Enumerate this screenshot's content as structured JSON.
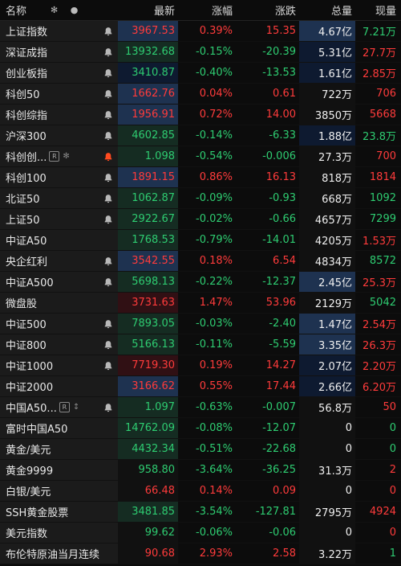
{
  "header": {
    "name": "名称",
    "latest": "最新",
    "pct": "涨幅",
    "chg": "涨跌",
    "volume": "总量",
    "current": "现量",
    "icons": [
      "settings-icon",
      "dot-icon"
    ]
  },
  "rows": [
    {
      "name": "上证指数",
      "bell": true,
      "latest": "3967.53",
      "pct": "0.39%",
      "chg": "15.35",
      "volume": "4.67亿",
      "current": "7.21万",
      "dir": "up",
      "curColor": "green"
    },
    {
      "name": "深证成指",
      "bell": true,
      "latest": "13932.68",
      "pct": "-0.15%",
      "chg": "-20.39",
      "volume": "5.31亿",
      "current": "27.7万",
      "dir": "down",
      "curColor": "red"
    },
    {
      "name": "创业板指",
      "bell": true,
      "latest": "3410.87",
      "pct": "-0.40%",
      "chg": "-13.53",
      "volume": "1.61亿",
      "current": "2.85万",
      "dir": "down",
      "curColor": "red"
    },
    {
      "name": "科创50",
      "bell": true,
      "latest": "1662.76",
      "pct": "0.04%",
      "chg": "0.61",
      "volume": "722万",
      "current": "706",
      "dir": "up",
      "curColor": "red"
    },
    {
      "name": "科创综指",
      "bell": true,
      "latest": "1956.91",
      "pct": "0.72%",
      "chg": "14.00",
      "volume": "3850万",
      "current": "5668",
      "dir": "up",
      "curColor": "red"
    },
    {
      "name": "沪深300",
      "bell": true,
      "latest": "4602.85",
      "pct": "-0.14%",
      "chg": "-6.33",
      "volume": "1.88亿",
      "current": "23.8万",
      "dir": "down",
      "curColor": "green"
    },
    {
      "name": "科创创...",
      "bell": true,
      "bellActive": true,
      "badges": true,
      "latest": "1.098",
      "pct": "-0.54%",
      "chg": "-0.006",
      "volume": "27.3万",
      "current": "700",
      "dir": "down",
      "curColor": "red"
    },
    {
      "name": "科创100",
      "bell": true,
      "latest": "1891.15",
      "pct": "0.86%",
      "chg": "16.13",
      "volume": "818万",
      "current": "1814",
      "dir": "up",
      "curColor": "red"
    },
    {
      "name": "北证50",
      "bell": true,
      "latest": "1062.87",
      "pct": "-0.09%",
      "chg": "-0.93",
      "volume": "668万",
      "current": "1092",
      "dir": "down",
      "curColor": "green"
    },
    {
      "name": "上证50",
      "bell": true,
      "latest": "2922.67",
      "pct": "-0.02%",
      "chg": "-0.66",
      "volume": "4657万",
      "current": "7299",
      "dir": "down",
      "curColor": "green"
    },
    {
      "name": "中证A50",
      "bell": false,
      "latest": "1768.53",
      "pct": "-0.79%",
      "chg": "-14.01",
      "volume": "4205万",
      "current": "1.53万",
      "dir": "down",
      "curColor": "red"
    },
    {
      "name": "央企红利",
      "bell": true,
      "latest": "3542.55",
      "pct": "0.18%",
      "chg": "6.54",
      "volume": "4834万",
      "current": "8572",
      "dir": "up",
      "curColor": "green"
    },
    {
      "name": "中证A500",
      "bell": true,
      "latest": "5698.13",
      "pct": "-0.22%",
      "chg": "-12.37",
      "volume": "2.45亿",
      "current": "25.3万",
      "dir": "down",
      "curColor": "red"
    },
    {
      "name": "微盘股",
      "bell": false,
      "latest": "3731.63",
      "pct": "1.47%",
      "chg": "53.96",
      "volume": "2129万",
      "current": "5042",
      "dir": "up",
      "curColor": "green"
    },
    {
      "name": "中证500",
      "bell": true,
      "latest": "7893.05",
      "pct": "-0.03%",
      "chg": "-2.40",
      "volume": "1.47亿",
      "current": "2.54万",
      "dir": "down",
      "curColor": "red"
    },
    {
      "name": "中证800",
      "bell": true,
      "latest": "5166.13",
      "pct": "-0.11%",
      "chg": "-5.59",
      "volume": "3.35亿",
      "current": "26.3万",
      "dir": "down",
      "curColor": "red"
    },
    {
      "name": "中证1000",
      "bell": true,
      "latest": "7719.30",
      "pct": "0.19%",
      "chg": "14.27",
      "volume": "2.07亿",
      "current": "2.20万",
      "dir": "up",
      "curColor": "red"
    },
    {
      "name": "中证2000",
      "bell": false,
      "latest": "3166.62",
      "pct": "0.55%",
      "chg": "17.44",
      "volume": "2.66亿",
      "current": "6.20万",
      "dir": "up",
      "curColor": "red"
    },
    {
      "name": "中国A50...",
      "bell": true,
      "badges2": true,
      "latest": "1.097",
      "pct": "-0.63%",
      "chg": "-0.007",
      "volume": "56.8万",
      "current": "50",
      "dir": "down",
      "curColor": "red"
    },
    {
      "name": "富时中国A50",
      "bell": false,
      "latest": "14762.09",
      "pct": "-0.08%",
      "chg": "-12.07",
      "volume": "0",
      "current": "0",
      "dir": "down",
      "curColor": "green"
    },
    {
      "name": "黄金/美元",
      "bell": false,
      "latest": "4432.34",
      "pct": "-0.51%",
      "chg": "-22.68",
      "volume": "0",
      "current": "0",
      "dir": "down",
      "curColor": "green"
    },
    {
      "name": "黄金9999",
      "bell": false,
      "latest": "958.80",
      "pct": "-3.64%",
      "chg": "-36.25",
      "volume": "31.3万",
      "current": "2",
      "dir": "down",
      "curColor": "red"
    },
    {
      "name": "白银/美元",
      "bell": false,
      "latest": "66.48",
      "pct": "0.14%",
      "chg": "0.09",
      "volume": "0",
      "current": "0",
      "dir": "up",
      "curColor": "red"
    },
    {
      "name": "SSH黄金股票",
      "bell": false,
      "latest": "3481.85",
      "pct": "-3.54%",
      "chg": "-127.81",
      "volume": "2795万",
      "current": "4924",
      "dir": "down",
      "curColor": "red"
    },
    {
      "name": "美元指数",
      "bell": false,
      "latest": "99.62",
      "pct": "-0.06%",
      "chg": "-0.06",
      "volume": "0",
      "current": "0",
      "dir": "down",
      "curColor": "red"
    },
    {
      "name": "布伦特原油当月连续",
      "bell": false,
      "latest": "90.68",
      "pct": "2.93%",
      "chg": "2.58",
      "volume": "3.22万",
      "current": "1",
      "dir": "up",
      "curColor": "green"
    }
  ],
  "colors": {
    "up": "#ff3b3b",
    "down": "#2ecc71"
  }
}
